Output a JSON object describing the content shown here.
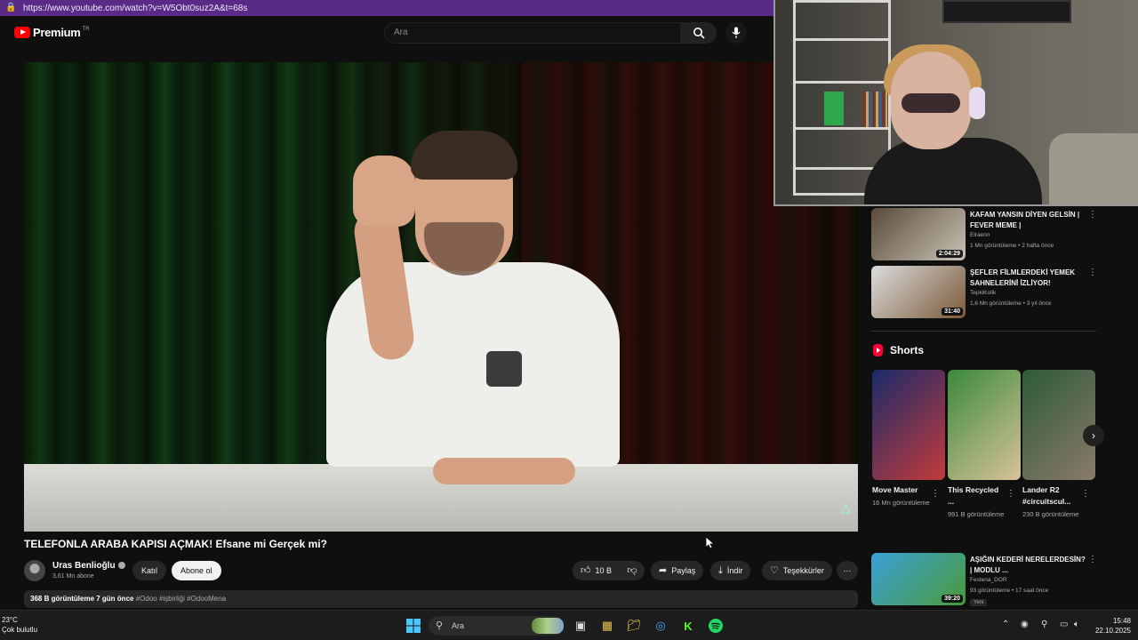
{
  "browser": {
    "url": "https://www.youtube.com/watch?v=W5Obt0suz2A&t=68s"
  },
  "header": {
    "logo_text": "Premium",
    "logo_sup": "TR",
    "search_placeholder": "Ara"
  },
  "video": {
    "title": "TELEFONLA ARABA KAPISI AÇMAK! Efsane mi Gerçek mi?",
    "channel_name": "Uras Benlioğlu",
    "subscribers": "3,61 Mn abone",
    "join_label": "Katıl",
    "subscribe_label": "Abone ol",
    "likes": "10 B",
    "share_label": "Paylaş",
    "download_label": "İndir",
    "thanks_label": "Teşekkürler",
    "description_stats": "368 B görüntüleme  7 gün önce",
    "description_tags": "#Odoo #işbirliği #OdooMena"
  },
  "sidebar": {
    "items": [
      {
        "title": "KAFAM YANSIN DİYEN GELSİN | FEVER MEME |",
        "channel": "Elraenn",
        "meta": "1 Mn görüntüleme • 2 hafta önce",
        "duration": "2:04:29",
        "colors": [
          "#5a4a3a",
          "#c9c2b5"
        ]
      },
      {
        "title": "ŞEFLER FİLMLERDEKİ YEMEK SAHNELERİNİ İZLİYOR!",
        "channel": "TepkiKolik",
        "meta": "1,6 Mn görüntüleme • 3 yıl önce",
        "duration": "31:40",
        "colors": [
          "#dcdcdc",
          "#7a5a3a"
        ]
      }
    ],
    "shorts_heading": "Shorts",
    "shorts": [
      {
        "name": "Move Master",
        "views": "16 Mn görüntüleme",
        "colors": [
          "#1a2a6a",
          "#c23b3b"
        ]
      },
      {
        "name": "This Recycled ...",
        "views": "991 B görüntüleme",
        "colors": [
          "#3a8a3a",
          "#d9c39a"
        ]
      },
      {
        "name": "Lander R2 #circuitscul...",
        "views": "230 B görüntüleme",
        "colors": [
          "#2d5a3a",
          "#8a7a6a"
        ]
      }
    ],
    "bottom_item": {
      "title": "AŞIĞIN KEDERİ NERELERDESİN? | MODLU ...",
      "channel": "Festena_DOR",
      "meta": "93 görüntüleme • 17 saat önce",
      "duration": "39:20",
      "badge": "Yeni",
      "colors": [
        "#3aa0d8",
        "#4a9a3a"
      ]
    }
  },
  "taskbar": {
    "temp": "23°C",
    "weather": "Çok bulutlu",
    "search_label": "Ara",
    "time": "15:48",
    "date": "22.10.2025"
  }
}
